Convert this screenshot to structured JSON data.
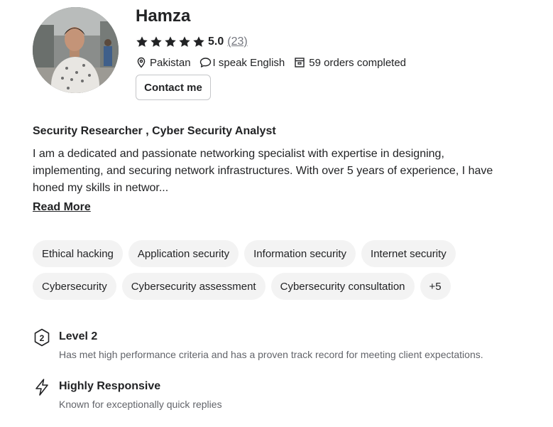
{
  "profile": {
    "name": "Hamza",
    "rating_score": "5.0",
    "rating_count": "(23)",
    "stars_filled": 5,
    "location": "Pakistan",
    "language": "I speak English",
    "orders": "59 orders completed",
    "contact_label": "Contact me"
  },
  "about": {
    "headline": "Security Researcher , Cyber Security Analyst",
    "bio_lines": [
      "I am a dedicated and passionate networking specialist with expertise in designing,",
      "implementing, and securing network infrastructures. With over 5 years of experience, I have",
      "honed my skills in networ..."
    ],
    "read_more": "Read More"
  },
  "skills": {
    "row1": [
      "Ethical hacking",
      "Application security",
      "Information security",
      "Internet security"
    ],
    "row2": [
      "Cybersecurity",
      "Cybersecurity assessment",
      "Cybersecurity consultation",
      "+5"
    ]
  },
  "badges": {
    "level": {
      "icon": "level-badge-icon",
      "number": "2",
      "title": "Level 2",
      "description": "Has met high performance criteria and has a proven track record for meeting client expectations."
    },
    "responsive": {
      "icon": "lightning-icon",
      "title": "Highly Responsive",
      "description": "Known for exceptionally quick replies"
    }
  },
  "colors": {
    "text": "#222325",
    "muted": "#74767e",
    "tag_bg": "#f3f3f3",
    "border": "#c5c6c9"
  }
}
